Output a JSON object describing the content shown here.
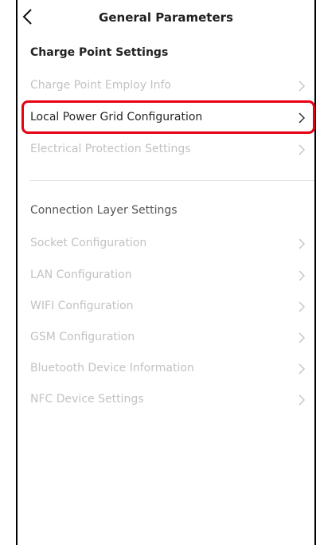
{
  "header": {
    "title": "General Parameters"
  },
  "sections": [
    {
      "title": "Charge Point Settings",
      "items": [
        {
          "label": "Charge Point Employ Info",
          "enabled": false
        },
        {
          "label": "Local Power Grid Configuration",
          "enabled": true
        },
        {
          "label": "Electrical Protection Settings",
          "enabled": false
        }
      ]
    },
    {
      "title": "Connection Layer Settings",
      "items": [
        {
          "label": "Socket Configuration",
          "enabled": false
        },
        {
          "label": "LAN Configuration",
          "enabled": false
        },
        {
          "label": "WIFI Configuration",
          "enabled": false
        },
        {
          "label": "GSM Configuration",
          "enabled": false
        },
        {
          "label": "Bluetooth Device Information",
          "enabled": false
        },
        {
          "label": "NFC Device Settings",
          "enabled": false
        }
      ]
    }
  ],
  "colors": {
    "highlight": "#e60012",
    "disabled_text": "#c2c2c2",
    "active_text": "#262626"
  },
  "icons": {
    "back": "chevron-left-icon",
    "row": "chevron-right-icon"
  }
}
